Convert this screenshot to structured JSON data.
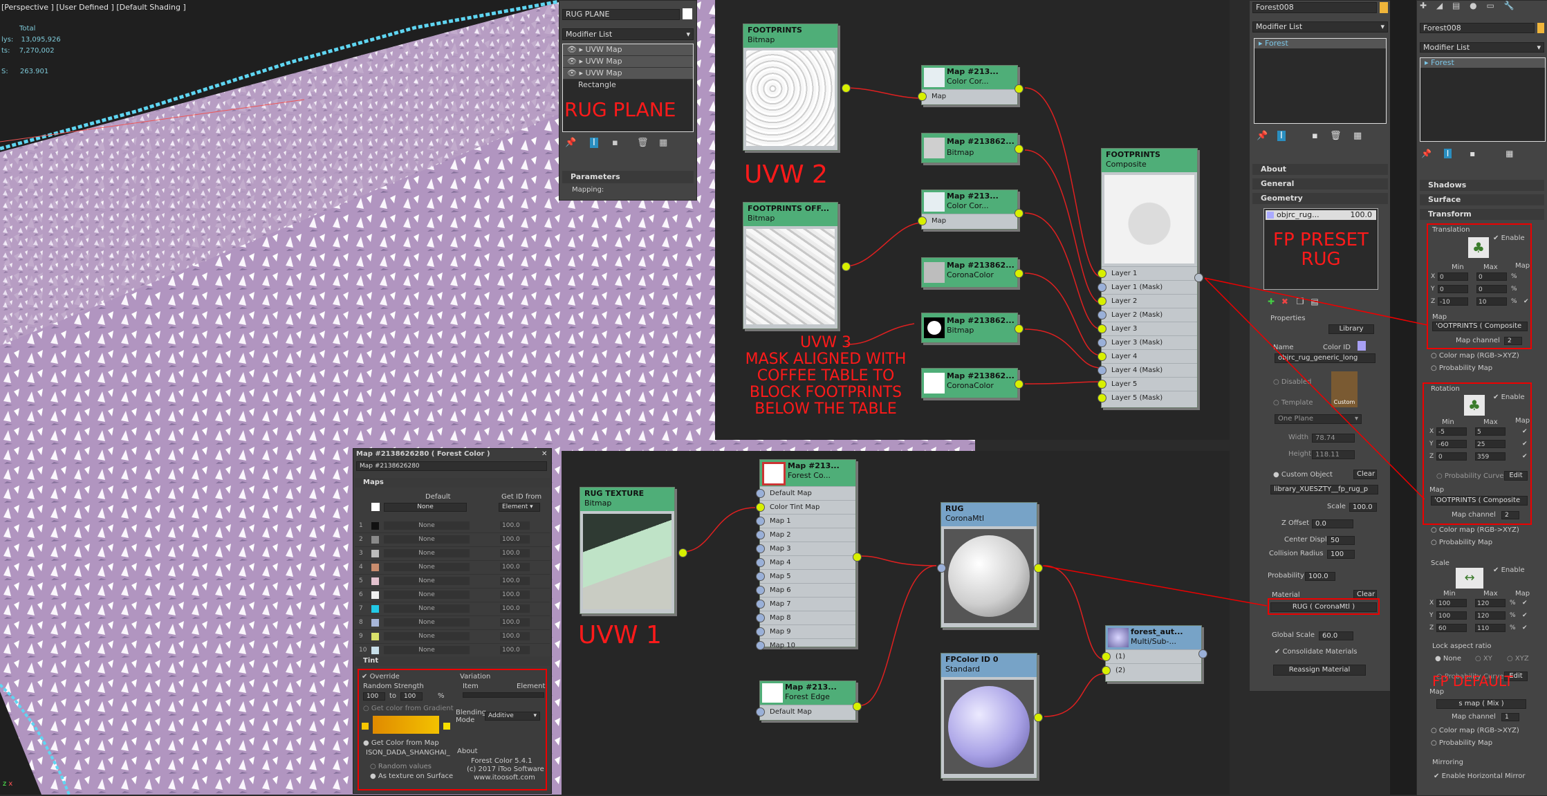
{
  "viewport": {
    "label": "[Perspective ] [User Defined ] [Default Shading ]",
    "stats": [
      {
        "label": "Total",
        "value": ""
      },
      {
        "label": "lys:",
        "value": "13,095,926"
      },
      {
        "label": "ts:",
        "value": "7,270,002"
      },
      {
        "label": "S:",
        "value": "263.901"
      }
    ]
  },
  "rug_modifier": {
    "object_name": "RUG PLANE",
    "modifier_list": "Modifier List",
    "stack": [
      "UVW Map",
      "UVW Map",
      "UVW Map",
      "Rectangle"
    ],
    "big_label": "RUG PLANE",
    "parameters": "Parameters",
    "mapping": "Mapping:"
  },
  "annotations": {
    "uvw2": "UVW 2",
    "uvw3": "UVW 3",
    "uvw3_note": [
      "MASK ALIGNED WITH",
      "COFFEE TABLE TO",
      "BLOCK FOOTPRINTS",
      "BELOW THE TABLE"
    ],
    "uvw1": "UVW 1",
    "fp_preset": [
      "FP PRESET",
      "RUG"
    ],
    "fp_default": "FP DEFAULT"
  },
  "nodes_top": {
    "bmp1": {
      "title": "FOOTPRINTS",
      "sub": "Bitmap"
    },
    "bmp2": {
      "title": "FOOTPRINTS  OFF...",
      "sub": "Bitmap"
    },
    "cc1": {
      "title": "Map #213...",
      "sub": "Color Cor...",
      "slot": "Map"
    },
    "bmpA": {
      "title": "Map #213862...",
      "sub": "Bitmap"
    },
    "cc2": {
      "title": "Map #213...",
      "sub": "Color Cor...",
      "slot": "Map"
    },
    "corA": {
      "title": "Map #213862...",
      "sub": "CoronaColor"
    },
    "bmpB": {
      "title": "Map #213862...",
      "sub": "Bitmap"
    },
    "corB": {
      "title": "Map #213862...",
      "sub": "CoronaColor"
    },
    "composite": {
      "title": "FOOTPRINTS",
      "sub": "Composite",
      "layers": [
        "Layer 1",
        "Layer 1 (Mask)",
        "Layer 2",
        "Layer 2 (Mask)",
        "Layer 3",
        "Layer 3 (Mask)",
        "Layer 4",
        "Layer 4 (Mask)",
        "Layer 5",
        "Layer 5 (Mask)"
      ]
    }
  },
  "forest_color_panel": {
    "title": "Map #2138626280  ( Forest Color )",
    "name": "Map #2138626280",
    "maps_rollout": "Maps",
    "default_label": "Default",
    "get_id_label": "Get ID from",
    "default_map": "None",
    "get_id_value": "Element",
    "rows": [
      {
        "n": "1",
        "map": "None",
        "pct": "100.0",
        "color": "#111111"
      },
      {
        "n": "2",
        "map": "None",
        "pct": "100.0",
        "color": "#8a8a8a"
      },
      {
        "n": "3",
        "map": "None",
        "pct": "100.0",
        "color": "#bcbcbc"
      },
      {
        "n": "4",
        "map": "None",
        "pct": "100.0",
        "color": "#c98c6e"
      },
      {
        "n": "5",
        "map": "None",
        "pct": "100.0",
        "color": "#e3c2cf"
      },
      {
        "n": "6",
        "map": "None",
        "pct": "100.0",
        "color": "#f0f0f0"
      },
      {
        "n": "7",
        "map": "None",
        "pct": "100.0",
        "color": "#22c9e6"
      },
      {
        "n": "8",
        "map": "None",
        "pct": "100.0",
        "color": "#a7b6d9"
      },
      {
        "n": "9",
        "map": "None",
        "pct": "100.0",
        "color": "#d9e06a"
      },
      {
        "n": "10",
        "map": "None",
        "pct": "100.0",
        "color": "#c8dfe9"
      }
    ],
    "tint_rollout": "Tint",
    "override": "Override",
    "random_strength": "Random Strength",
    "rs_from": "100",
    "rs_to_label": "to",
    "rs_to": "100",
    "rs_unit": "%",
    "get_color_gradient": "Get color from Gradient",
    "get_color_map": "Get Color from Map",
    "map_name": "ISON_DADA_SHANGHAI_I",
    "random_values": "Random values",
    "as_texture": "As texture on Surface",
    "variation": "Variation",
    "item": "Item",
    "element": "Element",
    "blending_mode": "Blending Mode",
    "blending_value": "Additive",
    "about": "About",
    "version": "Forest Color 5.4.1",
    "copyright": "(c) 2017 iToo Software",
    "url": "www.itoosoft.com"
  },
  "nodes_bottom": {
    "rugtex": {
      "title": "RUG TEXTURE",
      "sub": "Bitmap"
    },
    "forestco": {
      "title": "Map #213...",
      "sub": "Forest Co...",
      "slots": [
        "Default Map",
        "Color Tint Map",
        "Map 1",
        "Map 2",
        "Map 3",
        "Map 4",
        "Map 5",
        "Map 6",
        "Map 7",
        "Map 8",
        "Map 9",
        "Map 10"
      ]
    },
    "edge": {
      "title": "Map #213...",
      "sub": "Forest Edge",
      "slot": "Default Map"
    },
    "rugmtl": {
      "title": "RUG",
      "sub": "CoronaMtl"
    },
    "fpcolor": {
      "title": "FPColor ID 0",
      "sub": "Standard"
    },
    "multi": {
      "title": "forest_aut...",
      "sub": "Multi/Sub-...",
      "slots": [
        "(1)",
        "(2)"
      ]
    }
  },
  "forest_panel": {
    "object": "Forest008",
    "modifier_list": "Modifier List",
    "stack_item": "Forest",
    "rollouts": [
      "About",
      "General",
      "Geometry"
    ],
    "geo_name": "objrc_rug...",
    "geo_value": "100.0",
    "properties": "Properties",
    "library": "Library",
    "name_label": "Name",
    "color_id": "Color ID",
    "name_value": "objrc_rug_generic_long",
    "disabled": "Disabled",
    "template": "Template",
    "thumb_label": "Custom",
    "plane": "One Plane",
    "width_label": "Width",
    "width": "78.74",
    "height_label": "Height",
    "height": "118.11",
    "custom_object": "Custom Object",
    "clear": "Clear",
    "library_path": "library_XUESZTY__fp_rug_p",
    "scale_label": "Scale",
    "scale": "100.0",
    "zoffset_label": "Z Offset",
    "zoffset": "0.0",
    "center_label": "Center Displ.",
    "center": "50",
    "collision_label": "Collision Radius",
    "collision": "100",
    "probability_label": "Probability",
    "probability": "100.0",
    "material_label": "Material",
    "material": "RUG  ( CoronaMtl )",
    "global_scale_label": "Global Scale",
    "global_scale": "60.0",
    "consolidate": "Consolidate Materials",
    "reassign": "Reassign Material"
  },
  "far_panel": {
    "object": "Forest008",
    "modifier_list": "Modifier List",
    "stack_item": "Forest",
    "rollouts": [
      "Shadows",
      "Surface",
      "Transform"
    ],
    "translation": "Translation",
    "enable": "Enable",
    "min": "Min",
    "max": "Max",
    "map": "Map",
    "t_rows": [
      {
        "a": "X",
        "min": "0",
        "max": "0"
      },
      {
        "a": "Y",
        "min": "0",
        "max": "0"
      },
      {
        "a": "Z",
        "min": "-10",
        "max": "10"
      }
    ],
    "map_value": "'OOTPRINTS  ( Composite",
    "map_channel": "Map channel",
    "map_channel_value": "2",
    "color_map": "Color map (RGB->XYZ)",
    "prob_map": "Probability Map",
    "rotation": "Rotation",
    "r_rows": [
      {
        "a": "X",
        "min": "-5",
        "max": "5"
      },
      {
        "a": "Y",
        "min": "-60",
        "max": "25"
      },
      {
        "a": "Z",
        "min": "0",
        "max": "359"
      }
    ],
    "prob_curve": "Probability Curve",
    "edit": "Edit",
    "scale": "Scale",
    "s_rows": [
      {
        "a": "X",
        "min": "100",
        "max": "120"
      },
      {
        "a": "Y",
        "min": "100",
        "max": "120"
      },
      {
        "a": "Z",
        "min": "60",
        "max": "110"
      }
    ],
    "lock_aspect": "Lock aspect ratio",
    "lock_opts": [
      "None",
      "XY",
      "XYZ"
    ],
    "smap": "s map  ( Mix )",
    "map_channel_value2": "1",
    "mirroring": "Mirroring",
    "enable_mirror": "Enable Horizontal Mirror"
  }
}
